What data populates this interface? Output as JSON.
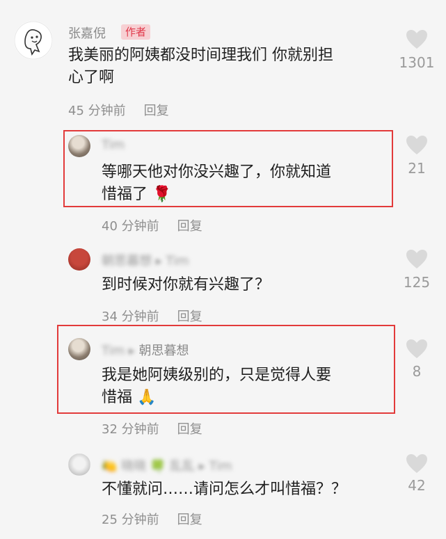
{
  "comments": [
    {
      "username": "张嘉倪",
      "badge": "作者",
      "text_lines": [
        "我美丽的阿姨都没时间理我们 你就别担",
        "心了啊"
      ],
      "time": "45 分钟前",
      "reply_label": "回复",
      "likes": "1301"
    },
    {
      "username": "Tim",
      "text_lines": [
        "等哪天他对你没兴趣了，你就知道",
        "惜福了 🌹"
      ],
      "time": "40 分钟前",
      "reply_label": "回复",
      "likes": "21"
    },
    {
      "username": "朝思暮想",
      "reply_to": "Tim",
      "text_lines": [
        "到时候对你就有兴趣了？"
      ],
      "time": "34 分钟前",
      "reply_label": "回复",
      "likes": "125"
    },
    {
      "username": "Tim",
      "reply_to": "朝思暮想",
      "text_lines": [
        "我是她阿姨级别的，只是觉得人要",
        "惜福 🙏"
      ],
      "time": "32 分钟前",
      "reply_label": "回复",
      "likes": "8"
    },
    {
      "username": "🍋 晓晓 🍀 乱乱",
      "reply_to": "Tim",
      "text_lines": [
        "不懂就问……请问怎么才叫惜福？？"
      ],
      "time": "25 分钟前",
      "reply_label": "回复",
      "likes": "42"
    }
  ],
  "colors": {
    "highlight_box": "#e23a3a",
    "author_badge_bg": "#f7d0d3",
    "author_badge_text": "#e0384a",
    "heart": "#d9d9d9"
  },
  "icons": [
    "heart-icon",
    "rose-emoji",
    "pray-emoji",
    "cartoon-avatar"
  ]
}
